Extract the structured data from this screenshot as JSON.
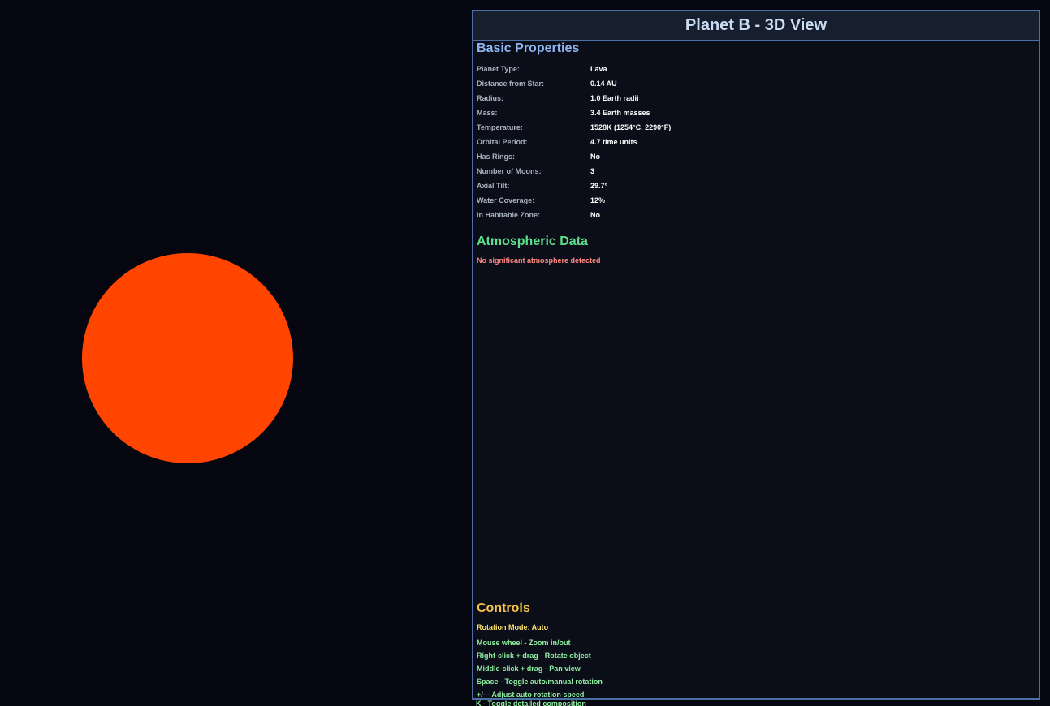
{
  "panel": {
    "title": "Planet B - 3D View"
  },
  "planet": {
    "color": "#ff4500"
  },
  "basic": {
    "title": "Basic Properties",
    "rows": [
      {
        "label": "Planet Type:",
        "value": "Lava"
      },
      {
        "label": "Distance from Star:",
        "value": "0.14 AU"
      },
      {
        "label": "Radius:",
        "value": "1.0 Earth radii"
      },
      {
        "label": "Mass:",
        "value": "3.4 Earth masses"
      },
      {
        "label": "Temperature:",
        "value": "1528K (1254°C, 2290°F)"
      },
      {
        "label": "Orbital Period:",
        "value": "4.7 time units"
      },
      {
        "label": "Has Rings:",
        "value": "No"
      },
      {
        "label": "Number of Moons:",
        "value": "3"
      },
      {
        "label": "Axial Tilt:",
        "value": "29.7°"
      },
      {
        "label": "Water Coverage:",
        "value": "12%"
      },
      {
        "label": "In Habitable Zone:",
        "value": "No"
      }
    ]
  },
  "atmosphere": {
    "title": "Atmospheric Data",
    "note": "No significant atmosphere detected"
  },
  "controls": {
    "title": "Controls",
    "rotation_mode": "Rotation Mode: Auto",
    "items": [
      "Mouse wheel - Zoom in/out",
      "Right-click + drag - Rotate object",
      "Middle-click + drag - Pan view",
      "Space - Toggle auto/manual rotation",
      "+/- - Adjust auto rotation speed"
    ],
    "overflow": "K - Toggle detailed composition"
  },
  "colors": {
    "accent": "#4a6fa5",
    "basic_title": "#8fb6f0",
    "atmo_title": "#5ee08a",
    "controls_title": "#f5c24a"
  }
}
